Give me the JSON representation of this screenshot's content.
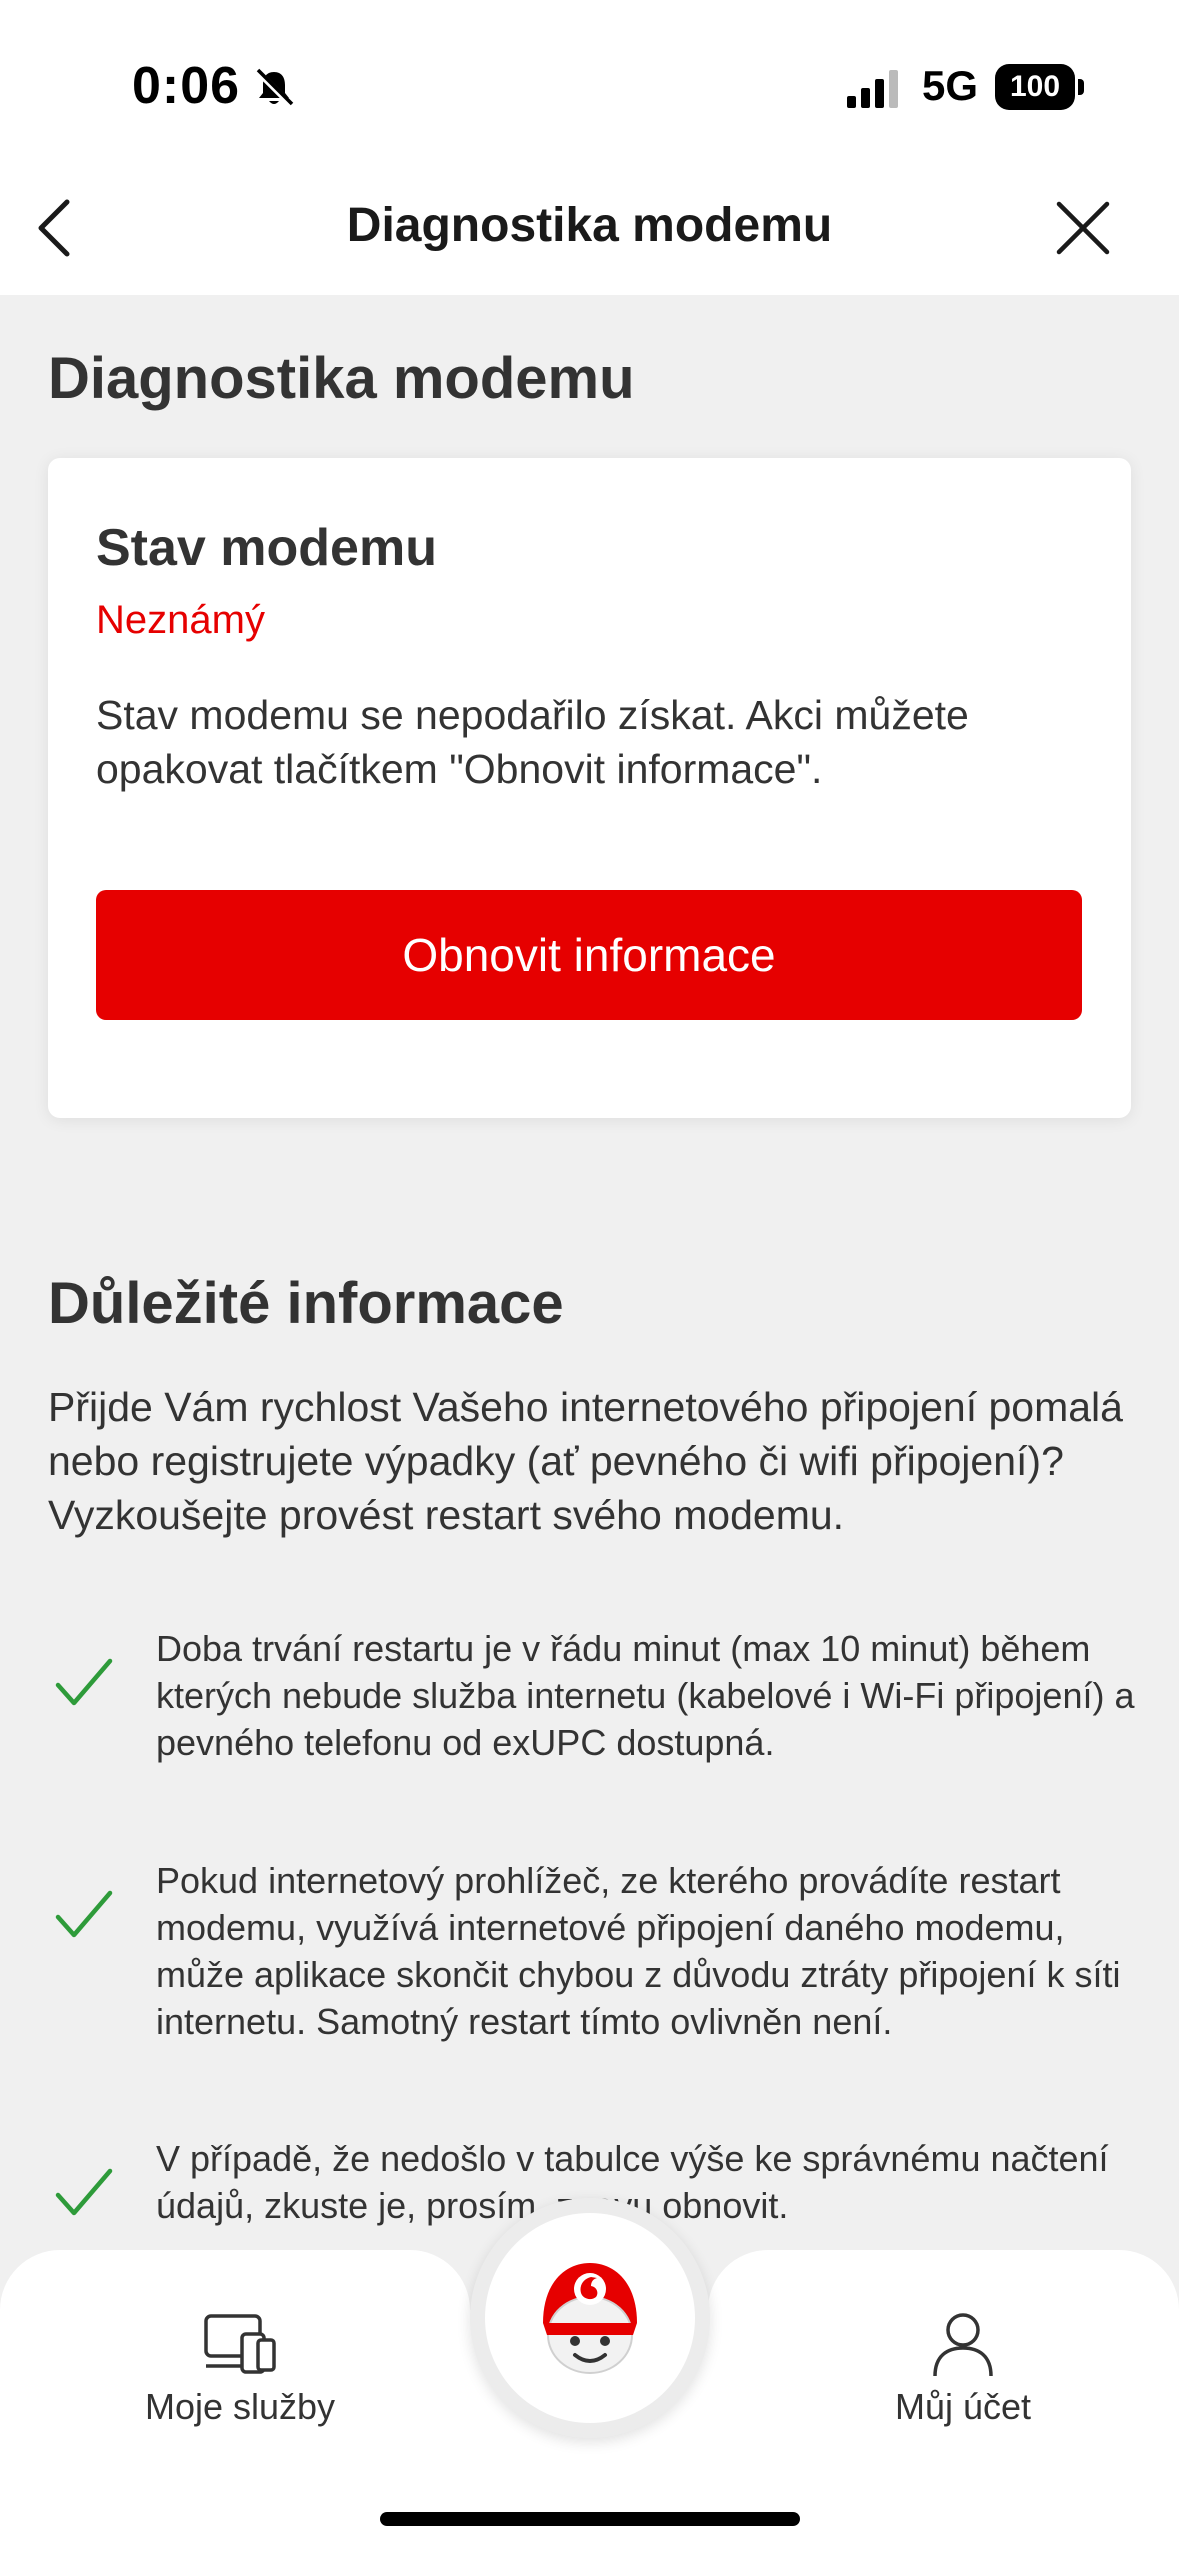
{
  "status_bar": {
    "time": "0:06",
    "network": "5G",
    "battery": "100",
    "icons": [
      "bell-slash-icon",
      "signal-bars-icon"
    ]
  },
  "header": {
    "title": "Diagnostika modemu",
    "back_icon": "chevron-left-icon",
    "close_icon": "close-icon"
  },
  "main": {
    "page_title": "Diagnostika modemu",
    "modem_card": {
      "title": "Stav modemu",
      "status": "Neznámý",
      "description": "Stav modemu se nepodařilo získat. Akci můžete opakovat tlačítkem \"Obnovit informace\".",
      "button_label": "Obnovit informace"
    },
    "info": {
      "title": "Důležité informace",
      "intro": "Přijde Vám rychlost Vašeho internetového připojení pomalá nebo registrujete výpadky (ať pevného či wifi připojení)? Vyzkoušejte provést restart svého modemu.",
      "items": [
        "Doba trvání restartu je v řádu minut (max 10 minut) během kterých nebude služba internetu (kabelové i Wi-Fi připojení) a pevného telefonu od exUPC dostupná.",
        "Pokud internetový prohlížeč, ze kterého provádíte restart modemu, využívá internetové připojení daného modemu, může aplikace skončit chybou z důvodu ztráty připojení k síti internetu. Samotný restart tímto ovlivněn není.",
        "V případě, že nedošlo v tabulce výše ke správnému načtení údajů, zkuste je, prosím, znovu obnovit."
      ]
    }
  },
  "bottom_nav": {
    "items": [
      {
        "label": "Moje služby",
        "icon": "devices-icon"
      },
      {
        "label": "Můj účet",
        "icon": "user-icon"
      }
    ],
    "center_icon": "assistant-avatar-icon"
  },
  "colors": {
    "accent": "#e60000",
    "check": "#2e9b3a",
    "background": "#f0f0f0"
  }
}
